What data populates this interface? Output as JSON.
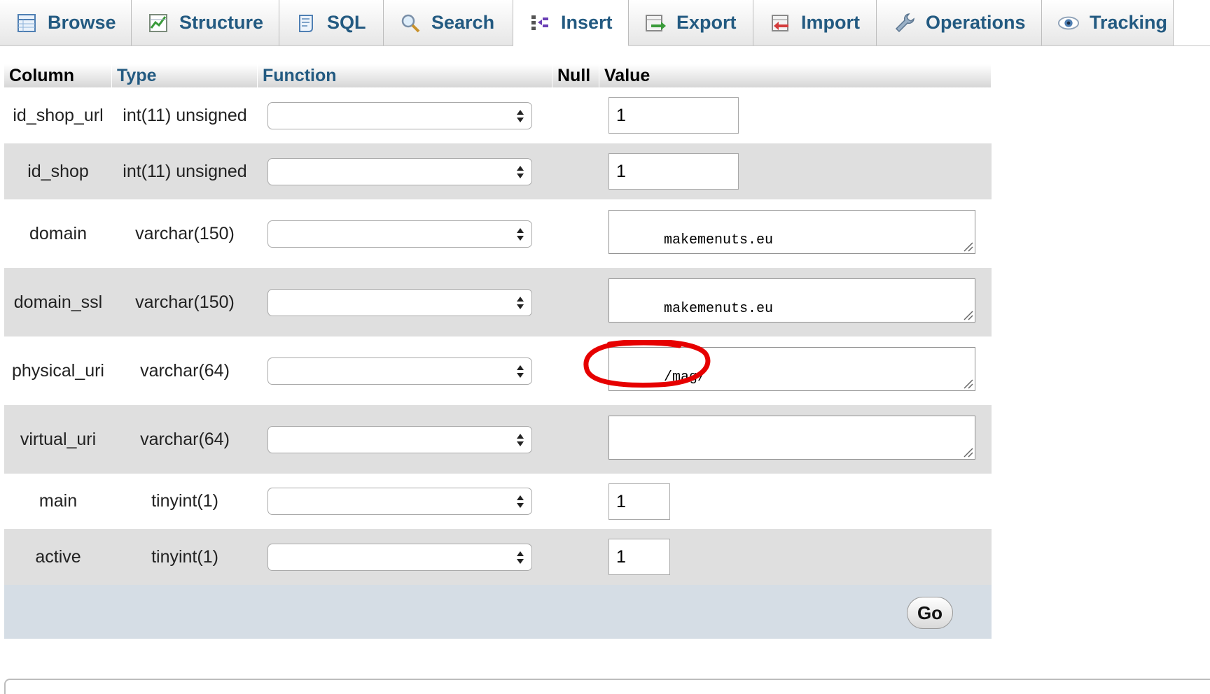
{
  "tabs": [
    {
      "label": "Browse",
      "icon": "browse-icon"
    },
    {
      "label": "Structure",
      "icon": "structure-icon"
    },
    {
      "label": "SQL",
      "icon": "sql-icon"
    },
    {
      "label": "Search",
      "icon": "search-icon"
    },
    {
      "label": "Insert",
      "icon": "insert-icon",
      "active": true
    },
    {
      "label": "Export",
      "icon": "export-icon"
    },
    {
      "label": "Import",
      "icon": "import-icon"
    },
    {
      "label": "Operations",
      "icon": "operations-icon"
    },
    {
      "label": "Tracking",
      "icon": "tracking-icon"
    }
  ],
  "table": {
    "headers": {
      "column": "Column",
      "type": "Type",
      "function": "Function",
      "null": "Null",
      "value": "Value"
    },
    "rows": [
      {
        "column": "id_shop_url",
        "type": "int(11) unsigned",
        "function": "",
        "value": "1"
      },
      {
        "column": "id_shop",
        "type": "int(11) unsigned",
        "function": "",
        "value": "1"
      },
      {
        "column": "domain",
        "type": "varchar(150)",
        "function": "",
        "value": "makemenuts.eu"
      },
      {
        "column": "domain_ssl",
        "type": "varchar(150)",
        "function": "",
        "value": "makemenuts.eu"
      },
      {
        "column": "physical_uri",
        "type": "varchar(64)",
        "function": "",
        "value": "/mag/"
      },
      {
        "column": "virtual_uri",
        "type": "varchar(64)",
        "function": "",
        "value": ""
      },
      {
        "column": "main",
        "type": "tinyint(1)",
        "function": "",
        "value": "1"
      },
      {
        "column": "active",
        "type": "tinyint(1)",
        "function": "",
        "value": "1"
      }
    ]
  },
  "actions": {
    "go_label": "Go"
  },
  "colors": {
    "link": "#235a81",
    "row_alt": "#dfdfdf",
    "footer": "#d5dde5",
    "highlight": "#e60000"
  }
}
